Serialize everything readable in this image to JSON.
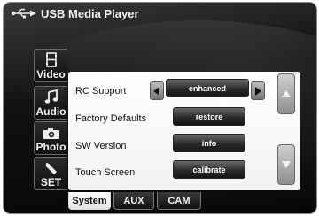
{
  "window": {
    "title": "USB Media Player",
    "title_icon": "usb-icon"
  },
  "side_tabs": [
    {
      "label": "Video",
      "icon": "film-icon"
    },
    {
      "label": "Audio",
      "icon": "music-note-icon"
    },
    {
      "label": "Photo",
      "icon": "camera-icon"
    },
    {
      "label": "SET",
      "icon": "wrench-icon"
    }
  ],
  "settings": {
    "rc_support": {
      "label": "RC Support",
      "value": "enhanced"
    },
    "factory_defaults": {
      "label": "Factory Defaults",
      "button": "restore"
    },
    "sw_version": {
      "label": "SW Version",
      "button": "info"
    },
    "touch_screen": {
      "label": "Touch Screen",
      "button": "calibrate"
    }
  },
  "bottom_tabs": [
    {
      "label": "System",
      "active": true
    },
    {
      "label": "AUX",
      "active": false
    },
    {
      "label": "CAM",
      "active": false
    }
  ],
  "colors": {
    "background": "#0a0a0a",
    "panel": "#f5f5f5",
    "button": "#2a2a2a",
    "text_light": "#f4f4f4"
  }
}
